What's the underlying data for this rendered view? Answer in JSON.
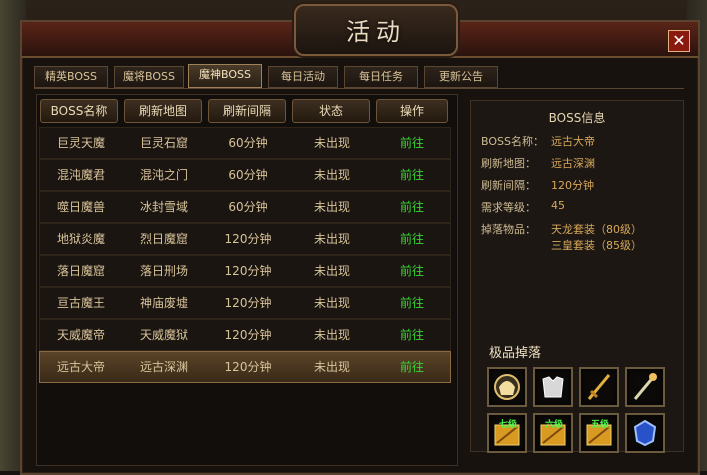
{
  "window": {
    "title": "活动",
    "close_label": "✕"
  },
  "tabs": [
    {
      "label": "精英BOSS"
    },
    {
      "label": "魔将BOSS"
    },
    {
      "label": "魔神BOSS"
    },
    {
      "label": "每日活动"
    },
    {
      "label": "每日任务"
    },
    {
      "label": "更新公告"
    }
  ],
  "active_tab": "魔神BOSS",
  "table": {
    "headers": [
      "BOSS名称",
      "刷新地图",
      "刷新间隔",
      "状态",
      "操作"
    ],
    "rows": [
      {
        "name": "巨灵天魔",
        "map": "巨灵石窟",
        "interval": "60分钟",
        "status": "未出现",
        "action": "前往"
      },
      {
        "name": "混沌魔君",
        "map": "混沌之门",
        "interval": "60分钟",
        "status": "未出现",
        "action": "前往"
      },
      {
        "name": "噬日魔兽",
        "map": "冰封雪域",
        "interval": "60分钟",
        "status": "未出现",
        "action": "前往"
      },
      {
        "name": "地狱炎魔",
        "map": "烈日魔窟",
        "interval": "120分钟",
        "status": "未出现",
        "action": "前往"
      },
      {
        "name": "落日魔窟",
        "map": "落日刑场",
        "interval": "120分钟",
        "status": "未出现",
        "action": "前往"
      },
      {
        "name": "亘古魔王",
        "map": "神庙废墟",
        "interval": "120分钟",
        "status": "未出现",
        "action": "前往"
      },
      {
        "name": "天威魔帝",
        "map": "天威魔狱",
        "interval": "120分钟",
        "status": "未出现",
        "action": "前往"
      },
      {
        "name": "远古大帝",
        "map": "远古深渊",
        "interval": "120分钟",
        "status": "未出现",
        "action": "前往"
      }
    ],
    "selected_row": 7
  },
  "boss_info": {
    "title": "BOSS信息",
    "name_label": "BOSS名称：",
    "name_value": "远古大帝",
    "map_label": "刷新地图：",
    "map_value": "远古深渊",
    "interval_label": "刷新间隔：",
    "interval_value": "120分钟",
    "level_label": "需求等级：",
    "level_value": "45",
    "drop_label": "掉落物品：",
    "drop_value_1": "天龙套装（80级）",
    "drop_value_2": "三皇套装（85级）"
  },
  "drops": {
    "title": "极品掉落",
    "items": [
      {
        "icon": "golden-helmet-icon"
      },
      {
        "icon": "silver-armor-icon"
      },
      {
        "icon": "sword-icon"
      },
      {
        "icon": "staff-icon"
      },
      {
        "icon": "scroll-bundle-icon",
        "badge": "七级"
      },
      {
        "icon": "scroll-bundle-icon",
        "badge": "六级"
      },
      {
        "icon": "scroll-bundle-icon",
        "badge": "五级"
      },
      {
        "icon": "blue-gem-icon"
      }
    ]
  },
  "colors": {
    "accent_green": "#39d437",
    "gold_text": "#d6a85a",
    "frame": "#5a4430"
  }
}
